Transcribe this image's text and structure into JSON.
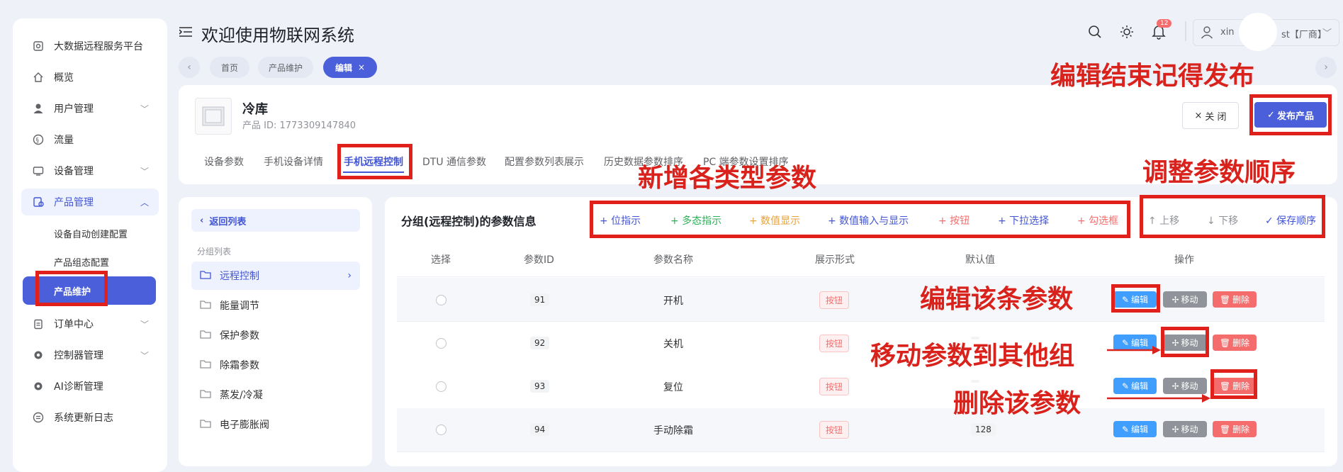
{
  "sidebar": {
    "items": [
      {
        "label": "大数据远程服务平台",
        "icon": "monitor-icon"
      },
      {
        "label": "概览",
        "icon": "home-icon"
      },
      {
        "label": "用户管理",
        "icon": "user-icon"
      },
      {
        "label": "流量",
        "icon": "flow-icon"
      },
      {
        "label": "设备管理",
        "icon": "device-icon"
      },
      {
        "label": "产品管理",
        "icon": "product-icon"
      },
      {
        "label": "订单中心",
        "icon": "clipboard-icon"
      },
      {
        "label": "控制器管理",
        "icon": "gear-icon"
      },
      {
        "label": "AI诊断管理",
        "icon": "gear-icon"
      },
      {
        "label": "系统更新日志",
        "icon": "log-icon"
      }
    ],
    "sub_items": [
      "设备自动创建配置",
      "产品组态配置",
      "产品维护"
    ]
  },
  "header": {
    "title": "欢迎使用物联网系统",
    "notification_count": "12",
    "user_prefix": "xin",
    "user_suffix": "st【厂商】"
  },
  "breadcrumb_tabs": [
    "首页",
    "产品维护",
    "编辑"
  ],
  "product": {
    "name": "冷库",
    "id_text": "产品 ID: 1773309147840",
    "close_label": "关 闭",
    "publish_label": "发布产品"
  },
  "tabs": [
    "设备参数",
    "手机设备详情",
    "手机远程控制",
    "DTU 通信参数",
    "配置参数列表展示",
    "历史数据参数排序",
    "PC 端参数设置排序"
  ],
  "groups": {
    "back_label": "返回列表",
    "section_label": "分组列表",
    "items": [
      "远程控制",
      "能量调节",
      "保护参数",
      "除霜参数",
      "蒸发/冷凝",
      "电子膨胀阀"
    ]
  },
  "params": {
    "title": "分组(远程控制)的参数信息",
    "toolbar": [
      "+ 位指示",
      "+ 多态指示",
      "+ 数值显示",
      "+ 数值输入与显示",
      "+ 按钮",
      "+ 下拉选择",
      "+ 勾选框"
    ],
    "order": [
      "↑ 上移",
      "↓ 下移",
      "✓ 保存顺序"
    ],
    "columns": [
      "选择",
      "参数ID",
      "参数名称",
      "展示形式",
      "默认值",
      "操作"
    ],
    "rows": [
      {
        "id": "91",
        "name": "开机",
        "form": "按钮",
        "default": ""
      },
      {
        "id": "92",
        "name": "关机",
        "form": "按钮",
        "default": ""
      },
      {
        "id": "93",
        "name": "复位",
        "form": "按钮",
        "default": ""
      },
      {
        "id": "94",
        "name": "手动除霜",
        "form": "按钮",
        "default": "128"
      }
    ],
    "actions": {
      "edit": "编辑",
      "move": "移动",
      "delete": "删除"
    }
  },
  "annotations": {
    "publish": "编辑结束记得发布",
    "add_types": "新增各类型参数",
    "reorder": "调整参数顺序",
    "edit": "编辑该条参数",
    "move": "移动参数到其他组",
    "delete": "删除该参数"
  },
  "colors": {
    "accent": "#4a5fd9",
    "annotation_red": "#e0201a"
  }
}
